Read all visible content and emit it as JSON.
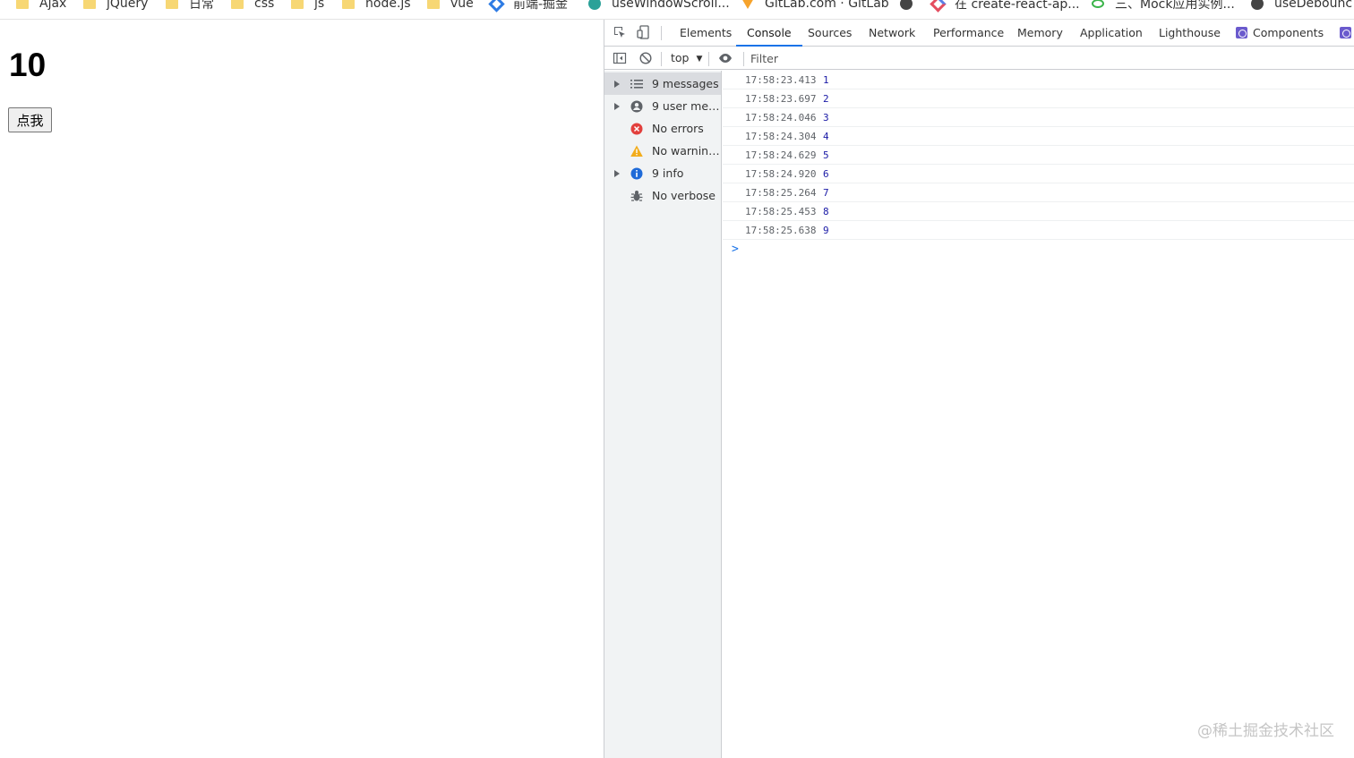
{
  "bookmarks": [
    {
      "label": "Ajax",
      "icon": "folder-icon"
    },
    {
      "label": "jQuery",
      "icon": "folder-icon"
    },
    {
      "label": "日常",
      "icon": "folder-icon"
    },
    {
      "label": "css",
      "icon": "folder-icon"
    },
    {
      "label": "js",
      "icon": "folder-icon"
    },
    {
      "label": "node.js",
      "icon": "folder-icon"
    },
    {
      "label": "vue",
      "icon": "folder-icon"
    },
    {
      "label": "前端-掘金",
      "icon": "juejin-icon"
    },
    {
      "label": "useWindowScroll...",
      "icon": "site-icon"
    },
    {
      "label": "GitLab.com · GitLab",
      "icon": "gitlab-icon"
    },
    {
      "label": "",
      "icon": "globe-icon"
    },
    {
      "label": "在 create-react-ap...",
      "icon": "site-icon"
    },
    {
      "label": "三、Mock应用实例...",
      "icon": "site-icon"
    },
    {
      "label": "useDebounc",
      "icon": "globe-icon"
    }
  ],
  "page": {
    "counter": "10",
    "button_label": "点我"
  },
  "devtools": {
    "tabs": [
      {
        "label": "Elements"
      },
      {
        "label": "Console"
      },
      {
        "label": "Sources"
      },
      {
        "label": "Network"
      },
      {
        "label": "Performance"
      },
      {
        "label": "Memory"
      },
      {
        "label": "Application"
      },
      {
        "label": "Lighthouse"
      },
      {
        "label": "Components"
      }
    ],
    "active_tab": "Console",
    "context": "top",
    "filter_placeholder": "Filter",
    "sidebar": [
      {
        "label": "9 messages",
        "icon": "list-icon"
      },
      {
        "label": "9 user mess...",
        "icon": "user-icon"
      },
      {
        "label": "No errors",
        "icon": "error-icon"
      },
      {
        "label": "No warnings",
        "icon": "warning-icon"
      },
      {
        "label": "9 info",
        "icon": "info-icon"
      },
      {
        "label": "No verbose",
        "icon": "bug-icon"
      }
    ],
    "messages": [
      {
        "time": "17:58:23.413",
        "value": "1"
      },
      {
        "time": "17:58:23.697",
        "value": "2"
      },
      {
        "time": "17:58:24.046",
        "value": "3"
      },
      {
        "time": "17:58:24.304",
        "value": "4"
      },
      {
        "time": "17:58:24.629",
        "value": "5"
      },
      {
        "time": "17:58:24.920",
        "value": "6"
      },
      {
        "time": "17:58:25.264",
        "value": "7"
      },
      {
        "time": "17:58:25.453",
        "value": "8"
      },
      {
        "time": "17:58:25.638",
        "value": "9"
      }
    ],
    "prompt": ">"
  },
  "watermark": "@稀土掘金技术社区",
  "colors": {
    "accent": "#1a73e8",
    "log_value": "#1a1aa6",
    "error": "#e2403d",
    "warning": "#f2ac1b",
    "info": "#1e6ad8"
  }
}
